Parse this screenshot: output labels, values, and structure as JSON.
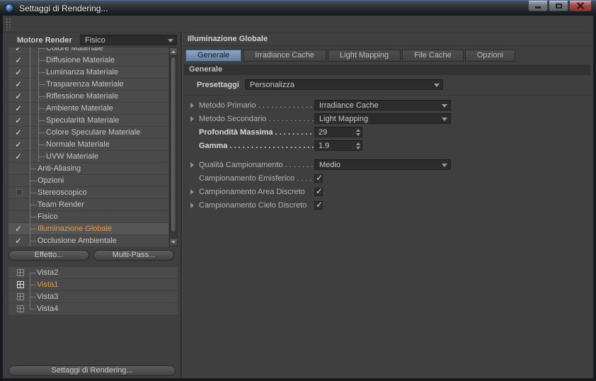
{
  "window": {
    "title": "Settaggi di Rendering..."
  },
  "icons": {
    "check": "✓"
  },
  "left": {
    "render_engine_label": "Motore Render",
    "render_engine_value": "Fisico",
    "tree": [
      {
        "label": "Colore Materiale",
        "check": "checked",
        "level": 2,
        "clipped": true
      },
      {
        "label": "Diffusione Materiale",
        "check": "checked",
        "level": 2
      },
      {
        "label": "Luminanza Materiale",
        "check": "checked",
        "level": 2
      },
      {
        "label": "Trasparenza Materiale",
        "check": "checked",
        "level": 2
      },
      {
        "label": "Riflessione Materiale",
        "check": "checked",
        "level": 2
      },
      {
        "label": "Ambiente Materiale",
        "check": "checked",
        "level": 2
      },
      {
        "label": "Specularità Materiale",
        "check": "checked",
        "level": 2
      },
      {
        "label": "Colore Speculare Materiale",
        "check": "checked",
        "level": 2
      },
      {
        "label": "Normale Materiale",
        "check": "checked",
        "level": 2
      },
      {
        "label": "UVW Materiale",
        "check": "checked",
        "level": 2
      },
      {
        "label": "Anti-Aliasing",
        "check": "none",
        "level": 1
      },
      {
        "label": "Opzioni",
        "check": "none",
        "level": 1
      },
      {
        "label": "Stereoscopico",
        "check": "unchecked",
        "level": 1
      },
      {
        "label": "Team Render",
        "check": "none",
        "level": 1
      },
      {
        "label": "Fisico",
        "check": "none",
        "level": 1
      },
      {
        "label": "Illuminazione Globale",
        "check": "checked",
        "level": 1,
        "selected": true
      },
      {
        "label": "Occlusione Ambientale",
        "check": "checked",
        "level": 1
      }
    ],
    "effect_button": "Effetto...",
    "multipass_button": "Multi-Pass...",
    "views": [
      {
        "label": "Vista2",
        "selected": false
      },
      {
        "label": "Vista1",
        "selected": true
      },
      {
        "label": "Vista3",
        "selected": false
      },
      {
        "label": "Vista4",
        "selected": false
      }
    ],
    "render_settings_button": "Settaggi di Rendering..."
  },
  "right": {
    "header": "Illuminazione Globale",
    "tabs": [
      {
        "label": "Generale",
        "active": true
      },
      {
        "label": "Irradiance Cache",
        "active": false
      },
      {
        "label": "Light Mapping",
        "active": false
      },
      {
        "label": "File Cache",
        "active": false
      },
      {
        "label": "Opzioni",
        "active": false
      }
    ],
    "section": "Generale",
    "preset_label": "Presettaggi",
    "preset_value": "Personalizza",
    "fields": [
      {
        "label": "Metodo Primario",
        "dots": ". . . . . . . . . . . . . . .",
        "type": "dropdown",
        "value": "Irradiance Cache",
        "arrow": true
      },
      {
        "label": "Metodo Secondario",
        "dots": ". . . . . . . . . . . . .",
        "type": "dropdown",
        "value": "Light Mapping",
        "arrow": true
      },
      {
        "label": "Profondità Massima",
        "dots": ". . . . . . . . . . . .",
        "type": "number",
        "value": "29",
        "arrow": false,
        "bold": true
      },
      {
        "label": "Gamma",
        "dots": ". . . . . . . . . . . . . . . . . . . . .",
        "type": "number",
        "value": "1.9",
        "arrow": false,
        "bold": true,
        "gap_after": true
      },
      {
        "label": "Qualità Campionamento",
        "dots": ". . . . . . . . .",
        "type": "dropdown",
        "value": "Medio",
        "arrow": true
      },
      {
        "label": "Campionamento Emisferico",
        "dots": ". . . . . .",
        "type": "checkbox",
        "value": true,
        "arrow": false
      },
      {
        "label": "Campionamento Area Discreto",
        "dots": "",
        "type": "checkbox",
        "value": true,
        "arrow": true
      },
      {
        "label": "Campionamento Cielo Discreto",
        "dots": "",
        "type": "checkbox",
        "value": true,
        "arrow": true
      }
    ]
  }
}
